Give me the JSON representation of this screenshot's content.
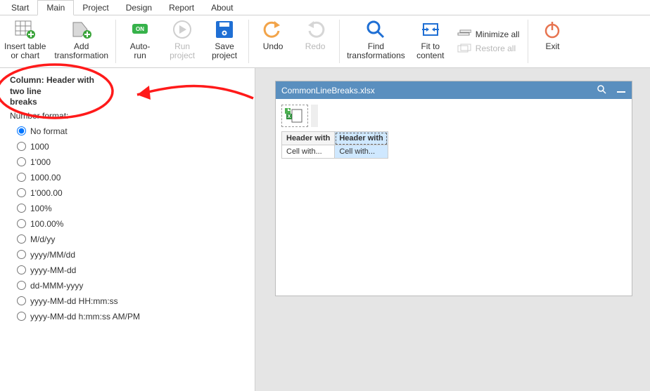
{
  "tabs": [
    "Start",
    "Main",
    "Project",
    "Design",
    "Report",
    "About"
  ],
  "ribbon": {
    "insert": "Insert table\nor chart",
    "addtrans": "Add\ntransformation",
    "autorun": "Auto-\nrun",
    "runproj": "Run\nproject",
    "saveproj": "Save\nproject",
    "undo": "Undo",
    "redo": "Redo",
    "findtrans": "Find\ntransformations",
    "fit": "Fit to\ncontent",
    "minall": "Minimize all",
    "restall": "Restore all",
    "exit": "Exit"
  },
  "left": {
    "heading": "Column: Header with\ntwo line\nbreaks",
    "nf": "Number format:",
    "opts": [
      "No format",
      "1000",
      "1'000",
      "1000.00",
      "1'000.00",
      "100%",
      "100.00%",
      "M/d/yy",
      "yyyy/MM/dd",
      "yyyy-MM-dd",
      "dd-MMM-yyyy",
      "yyyy-MM-dd HH:mm:ss",
      "yyyy-MM-dd h:mm:ss AM/PM"
    ],
    "selected": 0
  },
  "panel": {
    "title": "CommonLineBreaks.xlsx",
    "headers": [
      "Header with",
      "Header with"
    ],
    "row": [
      "Cell with...",
      "Cell with..."
    ]
  }
}
